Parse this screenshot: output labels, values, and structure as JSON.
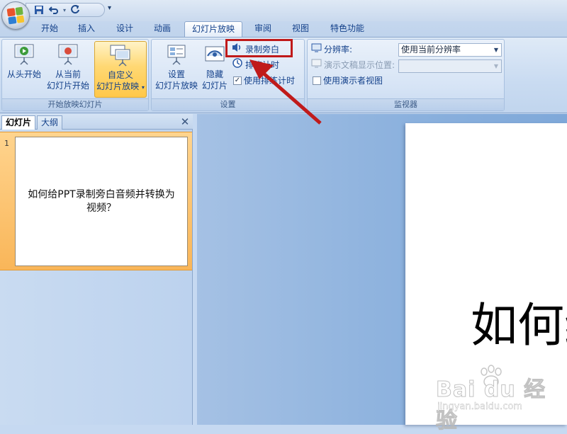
{
  "quick_access": {
    "save_icon": "save-icon",
    "undo_icon": "undo-icon",
    "redo_icon": "redo-icon",
    "customize_icon": "customize-qat-icon"
  },
  "tabs": [
    {
      "label": "开始"
    },
    {
      "label": "插入"
    },
    {
      "label": "设计"
    },
    {
      "label": "动画"
    },
    {
      "label": "幻灯片放映",
      "active": true
    },
    {
      "label": "审阅"
    },
    {
      "label": "视图"
    },
    {
      "label": "特色功能"
    }
  ],
  "ribbon": {
    "group_start": {
      "label": "开始放映幻灯片",
      "from_beginning": "从头开始",
      "from_current_line1": "从当前",
      "from_current_line2": "幻灯片开始",
      "custom_line1": "自定义",
      "custom_line2": "幻灯片放映"
    },
    "group_setup": {
      "label": "设置",
      "setup_line1": "设置",
      "setup_line2": "幻灯片放映",
      "hide_line1": "隐藏",
      "hide_line2": "幻灯片",
      "record_narration": "录制旁白",
      "rehearse_timings": "排练计时",
      "use_timings": "使用排练计时",
      "use_timings_checked": true
    },
    "group_monitors": {
      "label": "监视器",
      "resolution_label": "分辨率:",
      "resolution_value": "使用当前分辨率",
      "show_on_label": "演示文稿显示位置:",
      "show_on_value": "",
      "presenter_view": "使用演示者视图",
      "presenter_view_checked": false
    }
  },
  "left_pane": {
    "tab_slides": "幻灯片",
    "tab_outline": "大纲",
    "close_icon": "close-icon"
  },
  "slides": [
    {
      "number": "1",
      "title": "如何给PPT录制旁白音频并转换为视频？"
    }
  ],
  "main_slide": {
    "visible_title": "如何给"
  },
  "colors": {
    "highlight_box": "#c01a1a",
    "selected_thumb": "#f9b659",
    "ribbon_bg": "#d5e3f5"
  }
}
